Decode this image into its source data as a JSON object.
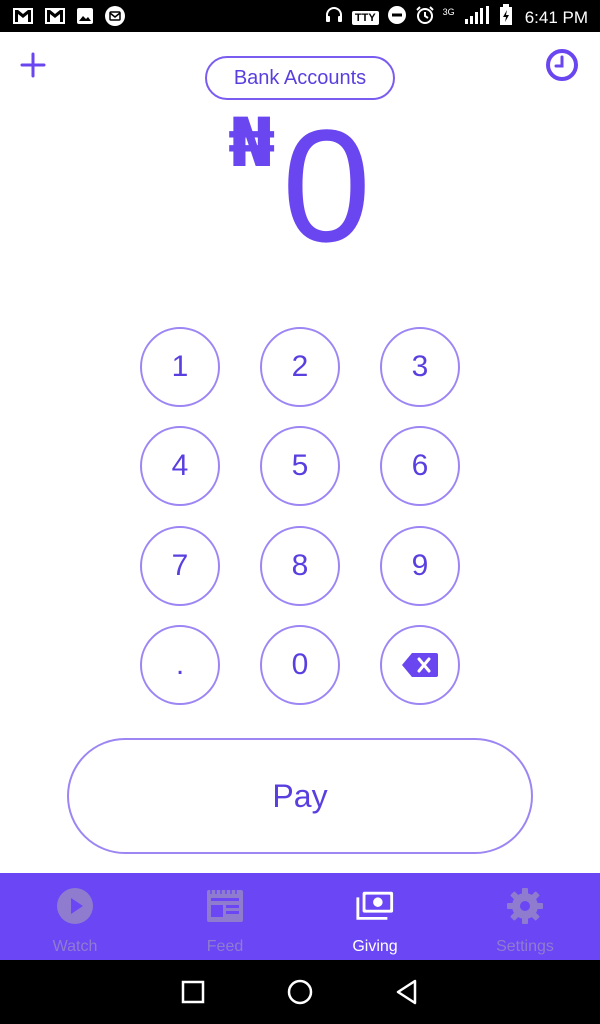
{
  "status_bar": {
    "time": "6:41 PM",
    "tty": "TTY",
    "network": "3G"
  },
  "header": {
    "bank_accounts_label": "Bank Accounts"
  },
  "amount": {
    "currency_symbol": "₦",
    "value": "0"
  },
  "keypad": {
    "keys": [
      "1",
      "2",
      "3",
      "4",
      "5",
      "6",
      "7",
      "8",
      "9",
      ".",
      "0"
    ]
  },
  "pay_label": "Pay",
  "bottom_nav": {
    "items": [
      {
        "label": "Watch",
        "icon": "play-icon"
      },
      {
        "label": "Feed",
        "icon": "newspaper-icon"
      },
      {
        "label": "Giving",
        "icon": "money-icon"
      },
      {
        "label": "Settings",
        "icon": "gear-icon"
      }
    ],
    "active": "Giving"
  },
  "colors": {
    "accent": "#6a46f0",
    "nav_background": "#6a46f5",
    "nav_inactive": "#8f7ccf"
  }
}
